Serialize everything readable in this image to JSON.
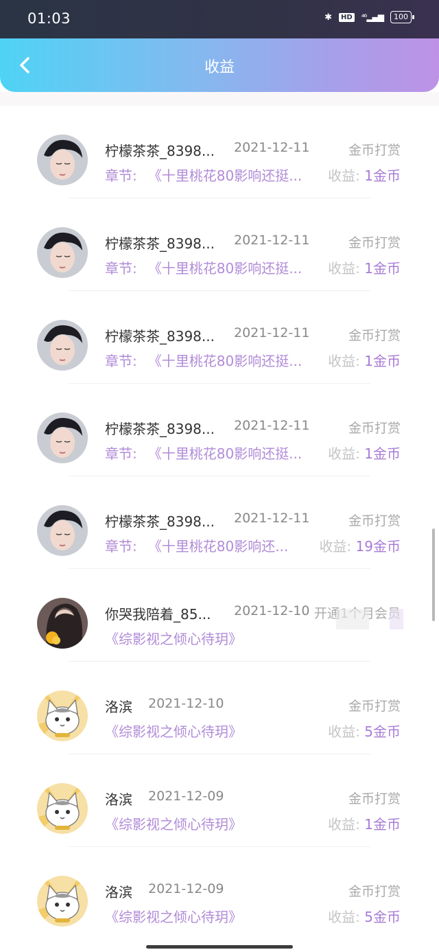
{
  "status": {
    "time": "01:03",
    "network": "⁴⁶",
    "battery": "100"
  },
  "nav": {
    "title": "收益"
  },
  "rows": [
    {
      "name": "柠檬茶茶_8398...",
      "date": "2021-12-11",
      "type": "金币打赏",
      "chapter_label": "章节:",
      "chapter": "《十里桃花80影响还挺...",
      "earn_label": "收益:",
      "earn_value": "1金币"
    },
    {
      "name": "柠檬茶茶_8398...",
      "date": "2021-12-11",
      "type": "金币打赏",
      "chapter_label": "章节:",
      "chapter": "《十里桃花80影响还挺...",
      "earn_label": "收益:",
      "earn_value": "1金币"
    },
    {
      "name": "柠檬茶茶_8398...",
      "date": "2021-12-11",
      "type": "金币打赏",
      "chapter_label": "章节:",
      "chapter": "《十里桃花80影响还挺...",
      "earn_label": "收益:",
      "earn_value": "1金币"
    },
    {
      "name": "柠檬茶茶_8398...",
      "date": "2021-12-11",
      "type": "金币打赏",
      "chapter_label": "章节:",
      "chapter": "《十里桃花80影响还挺...",
      "earn_label": "收益:",
      "earn_value": "1金币"
    },
    {
      "name": "柠檬茶茶_8398...",
      "date": "2021-12-11",
      "type": "金币打赏",
      "chapter_label": "章节:",
      "chapter": "《十里桃花80影响还...",
      "earn_label": "收益:",
      "earn_value": "19金币"
    },
    {
      "name": "你哭我陪着_85...",
      "date": "2021-12-10",
      "type": "开通1个月会员",
      "chapter": "《综影视之倾心待玥》"
    },
    {
      "name": "洛滨",
      "date": "2021-12-10",
      "type": "金币打赏",
      "chapter": "《综影视之倾心待玥》",
      "earn_label": "收益:",
      "earn_value": "5金币"
    },
    {
      "name": "洛滨",
      "date": "2021-12-09",
      "type": "金币打赏",
      "chapter": "《综影视之倾心待玥》",
      "earn_label": "收益:",
      "earn_value": "1金币"
    },
    {
      "name": "洛滨",
      "date": "2021-12-09",
      "type": "金币打赏",
      "chapter": "《综影视之倾心待玥》",
      "earn_label": "收益:",
      "earn_value": "5金币"
    }
  ],
  "colors": {
    "accent": "#a87bd6",
    "nav_start": "#4fd3f5",
    "nav_end": "#be92e6"
  }
}
